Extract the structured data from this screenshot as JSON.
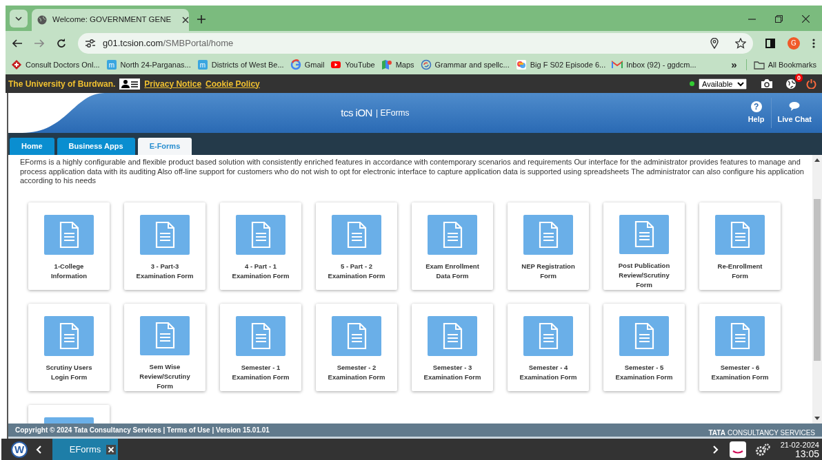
{
  "browser": {
    "tabs": [
      {
        "title": "Welcome: GOVERNMENT GENE",
        "selected": true
      }
    ],
    "url": {
      "host": "g01.tcsion.com",
      "path": "/SMBPortal/home"
    },
    "profile": "G",
    "bookmarks": [
      {
        "label": "Consult Doctors Onl...",
        "kind": "cross"
      },
      {
        "label": "North 24-Parganas...",
        "kind": "m"
      },
      {
        "label": "Districts of West Be...",
        "kind": "m"
      },
      {
        "label": "Gmail",
        "kind": "google"
      },
      {
        "label": "YouTube",
        "kind": "youtube"
      },
      {
        "label": "Maps",
        "kind": "maps"
      },
      {
        "label": "Grammar and spellc...",
        "kind": "circle"
      },
      {
        "label": "Big F S02 Episode 6...",
        "kind": "colorful"
      },
      {
        "label": "Inbox (92) - ggdcm...",
        "kind": "mail"
      }
    ],
    "overflow": "»",
    "all_bookmarks": "All Bookmarks"
  },
  "portal_bar": {
    "org": "The University of Burdwan.",
    "links": [
      "Privacy Notice",
      "Cookie Policy"
    ],
    "online": true,
    "status": "Available",
    "notifications": "0"
  },
  "header": {
    "logo": "tcs iON",
    "product": "| EForms",
    "actions": [
      {
        "label": "Help",
        "kind": "help",
        "icon": "?"
      },
      {
        "label": "Live Chat",
        "kind": "chat"
      }
    ]
  },
  "nav_tabs": [
    {
      "label": "Home",
      "selected": false
    },
    {
      "label": "Business Apps",
      "selected": false
    },
    {
      "label": "E-Forms",
      "selected": true
    }
  ],
  "description": "EForms is a highly configurable and flexible product based solution with consistently enriched features in accordance with contemporary scenarios and requirements Our interface for the administrator provides features to manage and process application data with its auditing Also off-line support for customers who do not wish to opt for electronic interface to capture application data is supported using spreadsheets The administrator can also configure his application according to his needs",
  "forms": [
    {
      "kind": "form",
      "label": "1-College Information"
    },
    {
      "kind": "form",
      "label": "3 - Part-3 Examination Form"
    },
    {
      "kind": "form",
      "label": "4 - Part - 1 Examination Form"
    },
    {
      "kind": "form",
      "label": "5 - Part - 2 Examination Form"
    },
    {
      "kind": "form",
      "label": "Exam Enrollment Data Form"
    },
    {
      "kind": "form",
      "label": "NEP Registration Form"
    },
    {
      "kind": "form",
      "label": "Post Publication Review/Scrutiny Form"
    },
    {
      "kind": "form",
      "label": "Re-Enrollment Form"
    },
    {
      "kind": "form",
      "label": "Scrutiny Users Login Form"
    },
    {
      "kind": "form",
      "label": "Sem Wise Review/Scrutiny Form"
    },
    {
      "kind": "form",
      "label": "Semester - 1 Examination Form"
    },
    {
      "kind": "form",
      "label": "Semester - 2 Examination Form"
    },
    {
      "kind": "form",
      "label": "Semester - 3 Examination Form"
    },
    {
      "kind": "form",
      "label": "Semester - 4 Examination Form"
    },
    {
      "kind": "form",
      "label": "Semester - 5 Examination Form"
    },
    {
      "kind": "form",
      "label": "Semester - 6 Examination Form"
    },
    {
      "kind": "form"
    }
  ],
  "footer": {
    "text": "Copyright © 2024 Tata Consultancy Services | Terms of Use | Version 15.01.01",
    "brand_bold": "TATA",
    "brand": "CONSULTANCY SERVICES"
  },
  "taskbar": {
    "logo": "W",
    "tabs": [
      {
        "label": "EForms",
        "selected": true
      }
    ],
    "date": "21-02-2024",
    "time": "13:05"
  }
}
